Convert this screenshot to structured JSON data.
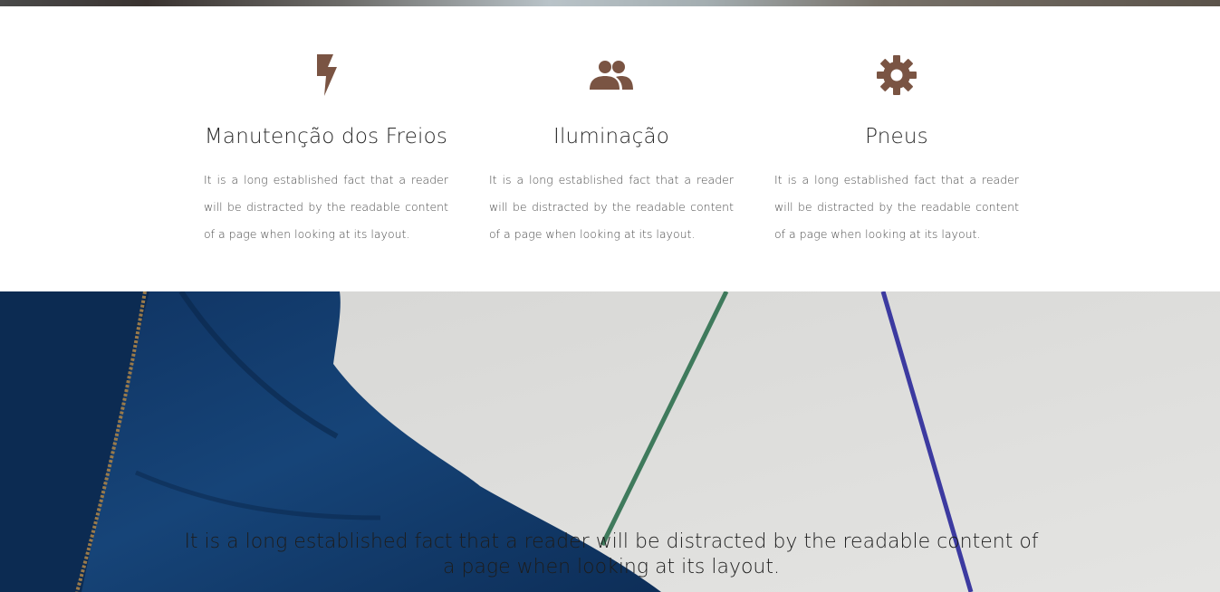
{
  "features": [
    {
      "icon": "bolt-icon",
      "title": "Manutenção dos Freios",
      "text": "It is a long established fact that a reader will be distracted by the readable content of a page when looking at its layout."
    },
    {
      "icon": "people-icon",
      "title": "Iluminação",
      "text": "It is a long established fact that a reader will be distracted by the readable content of a page when looking at its layout."
    },
    {
      "icon": "gear-icon",
      "title": "Pneus",
      "text": "It is a long established fact that a reader will be distracted by the readable content of a page when looking at its layout."
    }
  ],
  "hero": {
    "text": "It is a long established fact that a reader will be distracted by the readable content of a page when looking at its layout."
  },
  "colors": {
    "accent": "#7a5443",
    "heading": "#2a2a2a",
    "body_text": "#4b4b4b",
    "hero_background": "#dcdcda",
    "jacket": "#113a6b"
  }
}
